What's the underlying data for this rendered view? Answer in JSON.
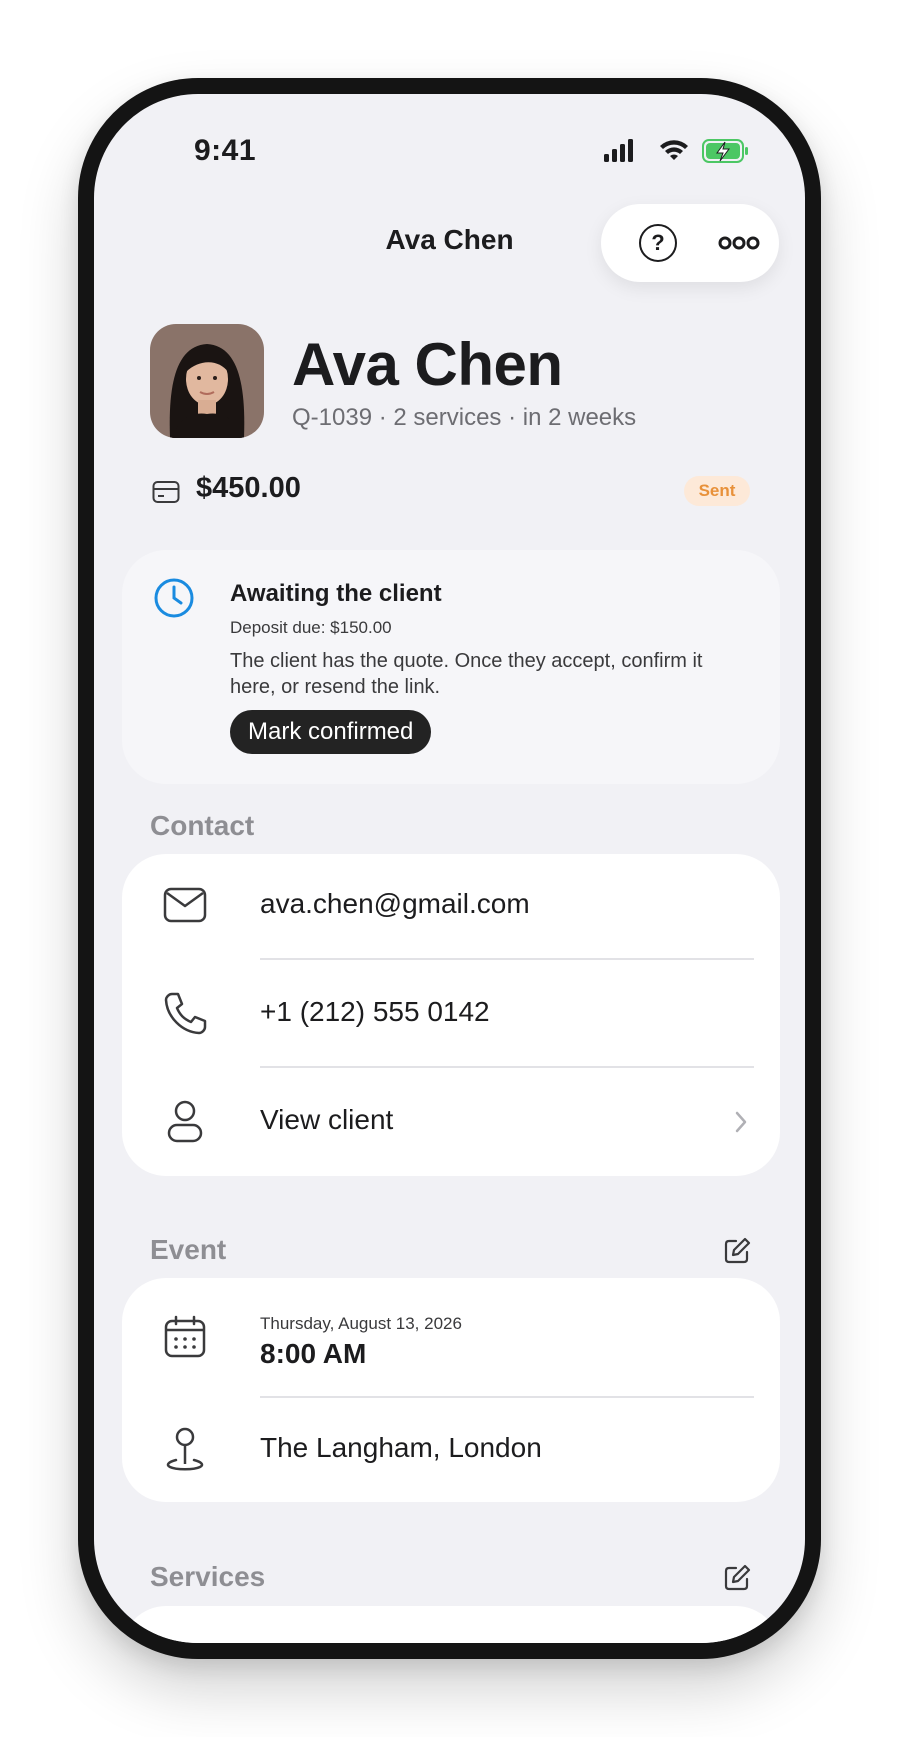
{
  "status_bar": {
    "time": "9:41"
  },
  "nav": {
    "title": "Ava Chen"
  },
  "client": {
    "name": "Ava Chen",
    "subtitle": "Q-1039 · 2 services · in 2 weeks",
    "price": "$450.00",
    "status_badge": "Sent"
  },
  "awaiting": {
    "title": "Awaiting the client",
    "deposit": "Deposit due: $150.00",
    "description": "The client has the quote. Once they accept, confirm it here, or resend the link.",
    "button": "Mark confirmed"
  },
  "contact": {
    "section_label": "Contact",
    "email": "ava.chen@gmail.com",
    "phone": "+1 (212) 555 0142",
    "view_client": "View client"
  },
  "event": {
    "section_label": "Event",
    "date": "Thursday, August 13, 2026",
    "time": "8:00 AM",
    "location": "The Langham, London"
  },
  "services": {
    "section_label": "Services"
  },
  "colors": {
    "background": "#f1f1f5",
    "badge_bg": "#fde9d8",
    "badge_text": "#e8913a",
    "accent_blue": "#1a8be0",
    "primary_button": "#232323"
  },
  "icons": [
    "signal-icon",
    "wifi-icon",
    "battery-charging-icon",
    "help-icon",
    "more-icon",
    "card-icon",
    "clock-icon",
    "mail-icon",
    "phone-icon",
    "person-icon",
    "chevron-right-icon",
    "edit-icon",
    "calendar-icon",
    "location-pin-icon"
  ]
}
